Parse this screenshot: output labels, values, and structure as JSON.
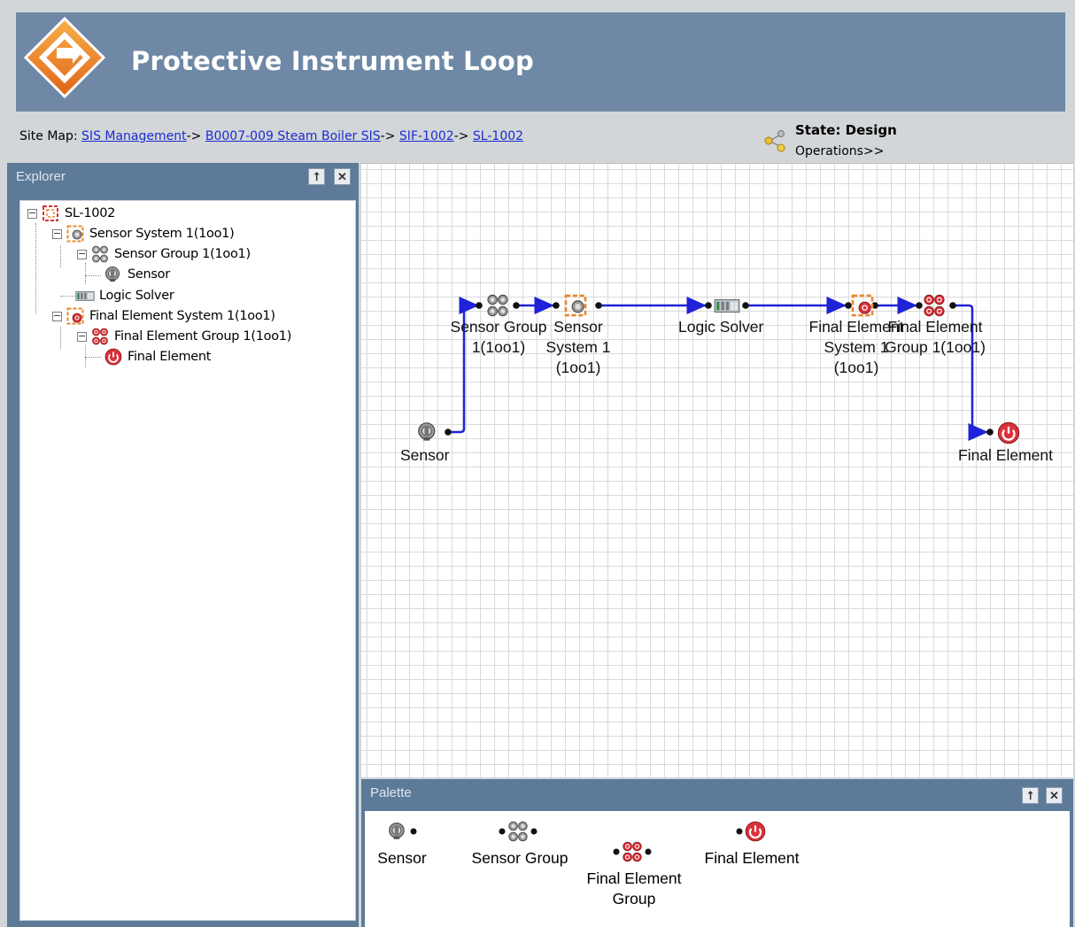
{
  "page": {
    "title": "Protective Instrument Loop"
  },
  "sitemap": {
    "prefix": "Site Map: ",
    "links": [
      "SIS Management",
      "B0007-009 Steam Boiler SIS",
      "SIF-1002",
      "SL-1002"
    ],
    "separator": "->"
  },
  "state": {
    "label": "State: Design",
    "operations": "Operations>>"
  },
  "explorer": {
    "title": "Explorer",
    "pin": "⭡",
    "close": "✕",
    "tree": [
      {
        "label": "SL-1002",
        "icon": "loop-icon",
        "expanded": true
      },
      {
        "label": "Sensor System 1(1oo1)",
        "icon": "sensor-system-icon",
        "expanded": true
      },
      {
        "label": "Sensor Group 1(1oo1)",
        "icon": "sensor-group-icon",
        "expanded": true
      },
      {
        "label": "Sensor",
        "icon": "sensor-icon"
      },
      {
        "label": "Logic Solver",
        "icon": "logic-solver-icon"
      },
      {
        "label": "Final Element System 1(1oo1)",
        "icon": "final-element-system-icon",
        "expanded": true
      },
      {
        "label": "Final Element Group 1(1oo1)",
        "icon": "final-element-group-icon",
        "expanded": true
      },
      {
        "label": "Final Element",
        "icon": "final-element-icon"
      }
    ]
  },
  "diagram": {
    "nodes": [
      {
        "id": "sensor",
        "label": "Sensor",
        "icon": "sensor-icon"
      },
      {
        "id": "sensor-group",
        "label": "Sensor Group\n1(1oo1)",
        "icon": "sensor-group-icon"
      },
      {
        "id": "sensor-system",
        "label": "Sensor\nSystem 1\n(1oo1)",
        "icon": "sensor-system-icon"
      },
      {
        "id": "logic-solver",
        "label": "Logic Solver",
        "icon": "logic-solver-icon"
      },
      {
        "id": "final-element-system",
        "label": "Final Element\nSystem 1\n(1oo1)",
        "icon": "final-element-system-icon"
      },
      {
        "id": "final-element-group",
        "label": "Final Element\nGroup 1(1oo1)",
        "icon": "final-element-group-icon"
      },
      {
        "id": "final-element",
        "label": "Final Element",
        "icon": "final-element-icon"
      }
    ],
    "connector_color": "#1f22d6"
  },
  "palette": {
    "title": "Palette",
    "pin": "⭡",
    "close": "✕",
    "items": [
      {
        "label": "Sensor",
        "icon": "sensor-icon"
      },
      {
        "label": "Sensor Group",
        "icon": "sensor-group-icon"
      },
      {
        "label": "Final Element\nGroup",
        "icon": "final-element-group-icon"
      },
      {
        "label": "Final Element",
        "icon": "final-element-icon"
      }
    ]
  },
  "colors": {
    "header": "#6e88a5",
    "panel": "#5d7a99",
    "link": "#1a2ccf",
    "final_element_red": "#d9323a",
    "sensor_system_orange": "#e8882c"
  }
}
